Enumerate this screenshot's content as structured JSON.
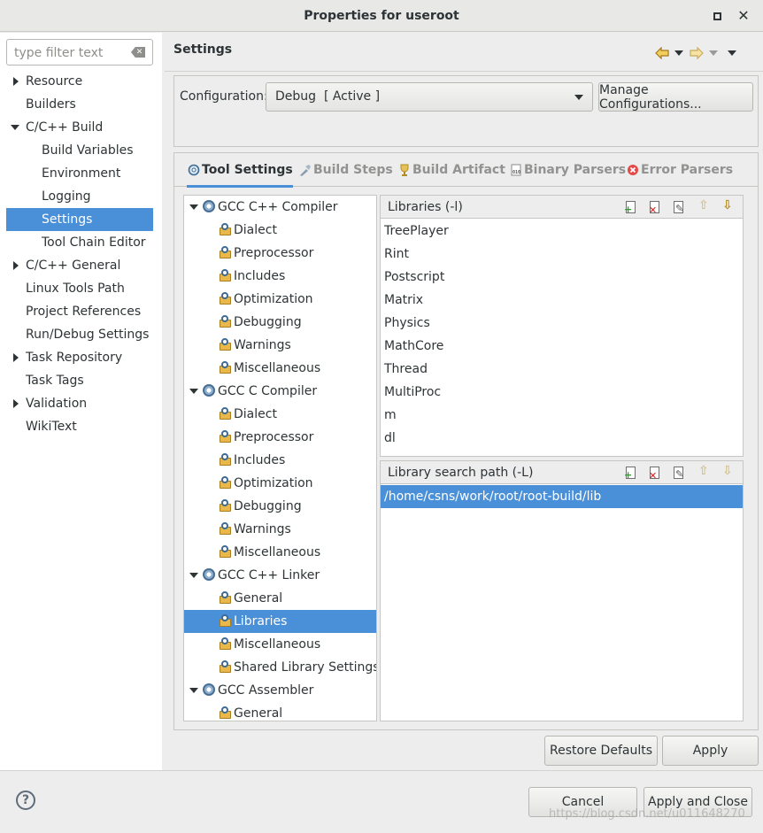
{
  "window": {
    "title": "Properties for useroot"
  },
  "filter": {
    "placeholder": "type filter text"
  },
  "sidebar": {
    "items": [
      {
        "label": "Resource",
        "expandable": true,
        "expanded": false
      },
      {
        "label": "Builders"
      },
      {
        "label": "C/C++ Build",
        "expandable": true,
        "expanded": true
      },
      {
        "label": "Build Variables"
      },
      {
        "label": "Environment"
      },
      {
        "label": "Logging"
      },
      {
        "label": "Settings",
        "selected": true
      },
      {
        "label": "Tool Chain Editor"
      },
      {
        "label": "C/C++ General",
        "expandable": true,
        "expanded": false
      },
      {
        "label": "Linux Tools Path"
      },
      {
        "label": "Project References"
      },
      {
        "label": "Run/Debug Settings"
      },
      {
        "label": "Task Repository",
        "expandable": true,
        "expanded": false
      },
      {
        "label": "Task Tags"
      },
      {
        "label": "Validation",
        "expandable": true,
        "expanded": false
      },
      {
        "label": "WikiText"
      }
    ]
  },
  "page": {
    "title": "Settings"
  },
  "config": {
    "label": "Configuration:",
    "value": "Debug  [ Active ]",
    "manage_label": "Manage Configurations..."
  },
  "tabs": [
    {
      "label": "Tool Settings",
      "icon": "tool-settings-icon",
      "active": true
    },
    {
      "label": "Build Steps",
      "icon": "build-steps-icon"
    },
    {
      "label": "Build Artifact",
      "icon": "build-artifact-icon"
    },
    {
      "label": "Binary Parsers",
      "icon": "binary-parsers-icon"
    },
    {
      "label": "Error Parsers",
      "icon": "error-parsers-icon"
    }
  ],
  "tree": {
    "groups": [
      {
        "label": "GCC C++ Compiler",
        "children": [
          "Dialect",
          "Preprocessor",
          "Includes",
          "Optimization",
          "Debugging",
          "Warnings",
          "Miscellaneous"
        ]
      },
      {
        "label": "GCC C Compiler",
        "children": [
          "Dialect",
          "Preprocessor",
          "Includes",
          "Optimization",
          "Debugging",
          "Warnings",
          "Miscellaneous"
        ]
      },
      {
        "label": "GCC C++ Linker",
        "children": [
          "General",
          "Libraries",
          "Miscellaneous",
          "Shared Library Settings"
        ]
      },
      {
        "label": "GCC Assembler",
        "children": [
          "General"
        ]
      }
    ],
    "selected": "GCC C++ Linker / Libraries"
  },
  "libraries": {
    "label": "Libraries (-l)",
    "items": [
      "TreePlayer",
      "Rint",
      "Postscript",
      "Matrix",
      "Physics",
      "MathCore",
      "Thread",
      "MultiProc",
      "m",
      "dl"
    ]
  },
  "search_path": {
    "label": "Library search path (-L)",
    "items": [
      "/home/csns/work/root/root-build/lib"
    ]
  },
  "buttons": {
    "restore_defaults": "Restore Defaults",
    "apply": "Apply",
    "cancel": "Cancel",
    "apply_and_close": "Apply and Close"
  },
  "watermark": "https://blog.csdn.net/u011648270",
  "colors": {
    "accent": "#4a90d9",
    "background": "#ededed"
  }
}
